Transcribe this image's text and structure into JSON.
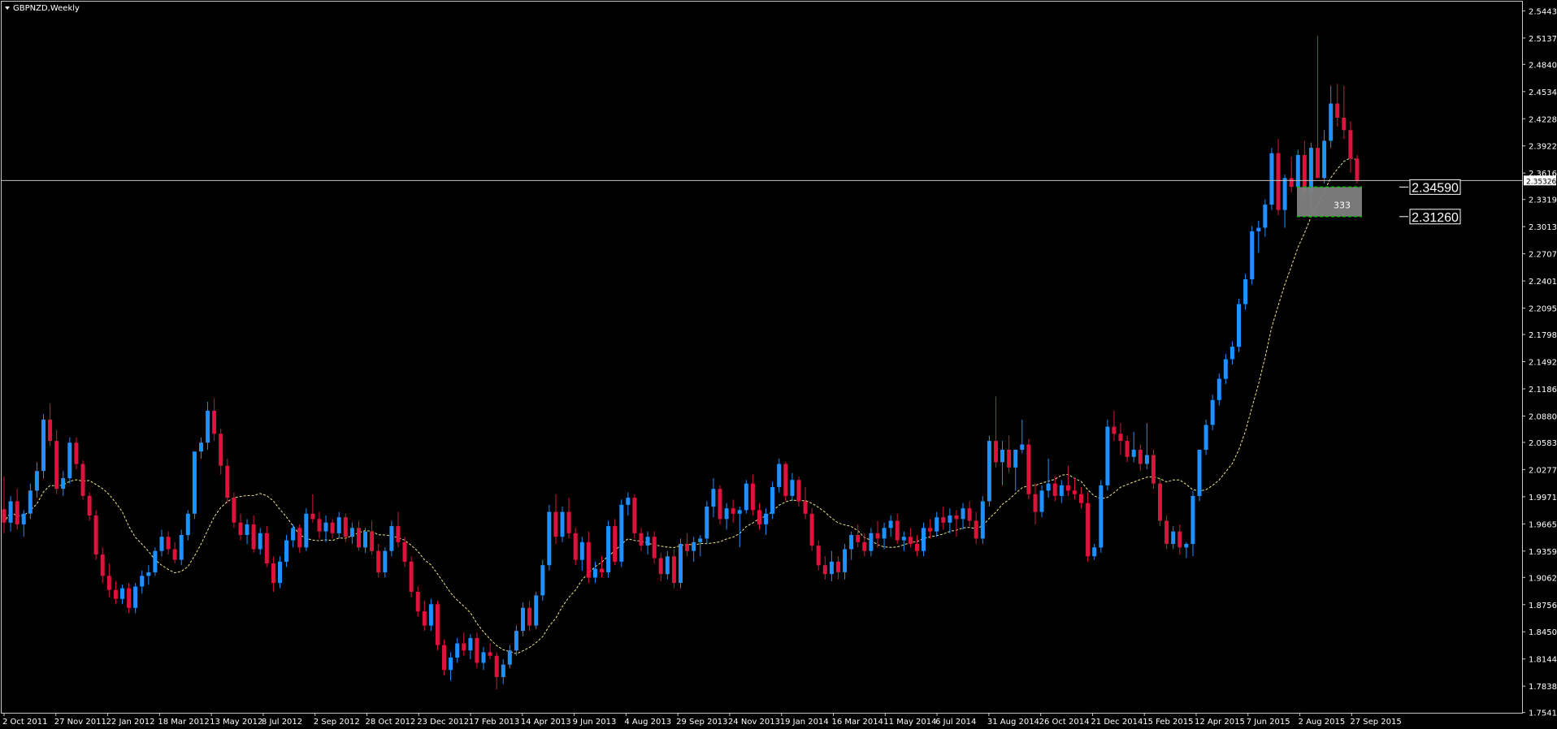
{
  "window": {
    "title": "GBPNZD,Weekly",
    "menu_icon": "triangle-down-icon"
  },
  "colors": {
    "background": "#000000",
    "frame": "#c8c8c8",
    "bull": "#1e90ff",
    "bear": "#dc143c",
    "doji": "#00c000",
    "ma": "#f0e68c",
    "zone_fill": "#808080",
    "zone_border": "#00c000",
    "text": "#ffffff"
  },
  "chart_data": {
    "type": "candlestick",
    "symbol": "GBPNZD",
    "timeframe": "Weekly",
    "ylim": [
      1.7538,
      2.5547
    ],
    "y_ticks": [
      "2.54430",
      "2.51370",
      "2.48400",
      "2.45340",
      "2.42280",
      "2.39220",
      "2.36160",
      "2.33190",
      "2.30130",
      "2.27070",
      "2.24010",
      "2.20950",
      "2.17980",
      "2.14920",
      "2.11860",
      "2.08800",
      "2.05830",
      "2.02770",
      "1.99710",
      "1.96650",
      "1.93590",
      "1.90620",
      "1.87560",
      "1.84500",
      "1.81440",
      "1.78380",
      "1.75410"
    ],
    "x_ticks": [
      "2 Oct 2011",
      "27 Nov 2011",
      "22 Jan 2012",
      "18 Mar 2012",
      "13 May 2012",
      "8 Jul 2012",
      "2 Sep 2012",
      "28 Oct 2012",
      "23 Dec 2012",
      "17 Feb 2013",
      "14 Apr 2013",
      "9 Jun 2013",
      "4 Aug 2013",
      "29 Sep 2013",
      "24 Nov 2013",
      "19 Jan 2014",
      "16 Mar 2014",
      "11 May 2014",
      "6 Jul 2014",
      "31 Aug 2014",
      "26 Oct 2014",
      "21 Dec 2014",
      "15 Feb 2015",
      "12 Apr 2015",
      "7 Jun 2015",
      "2 Aug 2015",
      "27 Sep 2015"
    ],
    "current_price": "2.35326",
    "zone": {
      "upper": "2.34590",
      "lower": "2.31260",
      "label": "333"
    },
    "moving_average": "yellow dashed",
    "grid": false,
    "bars": [
      [
        1.983,
        2.02,
        1.956,
        1.968
      ],
      [
        1.968,
        1.998,
        1.958,
        1.992
      ],
      [
        1.992,
        2.006,
        1.96,
        1.966
      ],
      [
        1.966,
        1.982,
        1.952,
        1.978
      ],
      [
        1.978,
        2.012,
        1.972,
        2.004
      ],
      [
        2.004,
        2.036,
        1.996,
        2.026
      ],
      [
        2.026,
        2.09,
        2.018,
        2.084
      ],
      [
        2.084,
        2.102,
        2.054,
        2.06
      ],
      [
        2.06,
        2.072,
        2.0,
        2.006
      ],
      [
        2.006,
        2.026,
        1.998,
        2.018
      ],
      [
        2.018,
        2.064,
        2.012,
        2.058
      ],
      [
        2.058,
        2.064,
        2.028,
        2.034
      ],
      [
        2.034,
        2.038,
        1.994,
        1.998
      ],
      [
        1.998,
        2.002,
        1.97,
        1.976
      ],
      [
        1.976,
        1.982,
        1.926,
        1.932
      ],
      [
        1.932,
        1.94,
        1.9,
        1.908
      ],
      [
        1.908,
        1.922,
        1.884,
        1.892
      ],
      [
        1.892,
        1.902,
        1.876,
        1.882
      ],
      [
        1.882,
        1.898,
        1.876,
        1.894
      ],
      [
        1.894,
        1.9,
        1.866,
        1.872
      ],
      [
        1.872,
        1.9,
        1.866,
        1.896
      ],
      [
        1.896,
        1.914,
        1.888,
        1.908
      ],
      [
        1.908,
        1.92,
        1.898,
        1.912
      ],
      [
        1.912,
        1.94,
        1.908,
        1.936
      ],
      [
        1.936,
        1.96,
        1.93,
        1.952
      ],
      [
        1.952,
        1.958,
        1.932,
        1.938
      ],
      [
        1.938,
        1.946,
        1.922,
        1.926
      ],
      [
        1.926,
        1.96,
        1.92,
        1.954
      ],
      [
        1.954,
        1.982,
        1.948,
        1.978
      ],
      [
        1.978,
        2.03,
        1.972,
        2.048
      ],
      [
        2.048,
        2.064,
        2.04,
        2.058
      ],
      [
        2.058,
        2.104,
        2.05,
        2.094
      ],
      [
        2.094,
        2.108,
        2.06,
        2.068
      ],
      [
        2.068,
        2.074,
        2.022,
        2.032
      ],
      [
        2.032,
        2.04,
        1.99,
        1.996
      ],
      [
        1.996,
        2.002,
        1.962,
        1.968
      ],
      [
        1.968,
        1.978,
        1.948,
        1.954
      ],
      [
        1.954,
        1.972,
        1.944,
        1.966
      ],
      [
        1.966,
        1.976,
        1.934,
        1.938
      ],
      [
        1.938,
        1.962,
        1.932,
        1.956
      ],
      [
        1.956,
        1.964,
        1.918,
        1.922
      ],
      [
        1.922,
        1.93,
        1.89,
        1.9
      ],
      [
        1.9,
        1.93,
        1.894,
        1.924
      ],
      [
        1.924,
        1.954,
        1.918,
        1.948
      ],
      [
        1.948,
        1.966,
        1.94,
        1.962
      ],
      [
        1.962,
        1.966,
        1.934,
        1.94
      ],
      [
        1.94,
        1.984,
        1.936,
        1.978
      ],
      [
        1.978,
        2.0,
        1.968,
        1.972
      ],
      [
        1.972,
        1.98,
        1.95,
        1.958
      ],
      [
        1.958,
        1.976,
        1.946,
        1.968
      ],
      [
        1.968,
        1.972,
        1.95,
        1.956
      ],
      [
        1.956,
        1.98,
        1.95,
        1.974
      ],
      [
        1.974,
        1.978,
        1.946,
        1.952
      ],
      [
        1.952,
        1.968,
        1.944,
        1.962
      ],
      [
        1.962,
        1.97,
        1.936,
        1.94
      ],
      [
        1.94,
        1.962,
        1.934,
        1.958
      ],
      [
        1.958,
        1.97,
        1.932,
        1.936
      ],
      [
        1.936,
        1.944,
        1.906,
        1.912
      ],
      [
        1.912,
        1.94,
        1.906,
        1.936
      ],
      [
        1.936,
        1.97,
        1.93,
        1.964
      ],
      [
        1.964,
        1.98,
        1.94,
        1.946
      ],
      [
        1.946,
        1.952,
        1.918,
        1.924
      ],
      [
        1.924,
        1.93,
        1.884,
        1.89
      ],
      [
        1.89,
        1.896,
        1.862,
        1.868
      ],
      [
        1.868,
        1.88,
        1.846,
        1.852
      ],
      [
        1.852,
        1.882,
        1.846,
        1.876
      ],
      [
        1.876,
        1.88,
        1.824,
        1.83
      ],
      [
        1.83,
        1.836,
        1.796,
        1.802
      ],
      [
        1.802,
        1.822,
        1.79,
        1.816
      ],
      [
        1.816,
        1.838,
        1.81,
        1.832
      ],
      [
        1.832,
        1.844,
        1.818,
        1.824
      ],
      [
        1.824,
        1.842,
        1.814,
        1.838
      ],
      [
        1.838,
        1.844,
        1.804,
        1.81
      ],
      [
        1.81,
        1.828,
        1.802,
        1.822
      ],
      [
        1.822,
        1.832,
        1.814,
        1.818
      ],
      [
        1.818,
        1.822,
        1.78,
        1.794
      ],
      [
        1.794,
        1.814,
        1.786,
        1.808
      ],
      [
        1.808,
        1.83,
        1.804,
        1.824
      ],
      [
        1.824,
        1.852,
        1.818,
        1.846
      ],
      [
        1.846,
        1.878,
        1.84,
        1.872
      ],
      [
        1.872,
        1.88,
        1.846,
        1.852
      ],
      [
        1.852,
        1.89,
        1.848,
        1.886
      ],
      [
        1.886,
        1.926,
        1.88,
        1.92
      ],
      [
        1.92,
        1.988,
        1.914,
        1.98
      ],
      [
        1.98,
        2.0,
        1.944,
        1.952
      ],
      [
        1.952,
        1.986,
        1.946,
        1.98
      ],
      [
        1.98,
        1.996,
        1.95,
        1.956
      ],
      [
        1.956,
        1.962,
        1.92,
        1.926
      ],
      [
        1.926,
        1.952,
        1.914,
        1.946
      ],
      [
        1.946,
        1.958,
        1.9,
        1.906
      ],
      [
        1.906,
        1.924,
        1.9,
        1.916
      ],
      [
        1.916,
        1.93,
        1.906,
        1.912
      ],
      [
        1.912,
        1.97,
        1.906,
        1.964
      ],
      [
        1.964,
        1.972,
        1.92,
        1.924
      ],
      [
        1.924,
        1.994,
        1.918,
        1.988
      ],
      [
        1.988,
        2.002,
        1.976,
        1.996
      ],
      [
        1.996,
        2.0,
        1.95,
        1.956
      ],
      [
        1.956,
        1.962,
        1.936,
        1.942
      ],
      [
        1.942,
        1.958,
        1.932,
        1.952
      ],
      [
        1.952,
        1.958,
        1.922,
        1.928
      ],
      [
        1.928,
        1.934,
        1.902,
        1.91
      ],
      [
        1.91,
        1.936,
        1.904,
        1.93
      ],
      [
        1.93,
        1.938,
        1.894,
        1.9
      ],
      [
        1.9,
        1.95,
        1.894,
        1.944
      ],
      [
        1.944,
        1.956,
        1.93,
        1.936
      ],
      [
        1.936,
        1.952,
        1.924,
        1.946
      ],
      [
        1.946,
        1.954,
        1.93,
        1.95
      ],
      [
        1.95,
        1.992,
        1.944,
        1.986
      ],
      [
        1.986,
        2.018,
        1.974,
        2.006
      ],
      [
        2.006,
        2.01,
        1.966,
        1.972
      ],
      [
        1.972,
        1.99,
        1.96,
        1.984
      ],
      [
        1.984,
        1.994,
        1.968,
        1.978
      ],
      [
        1.978,
        1.986,
        1.94,
        1.982
      ],
      [
        1.982,
        2.016,
        1.978,
        2.012
      ],
      [
        2.012,
        2.022,
        1.976,
        1.982
      ],
      [
        1.982,
        1.99,
        1.96,
        1.966
      ],
      [
        1.966,
        1.984,
        1.954,
        1.978
      ],
      [
        1.978,
        2.014,
        1.972,
        2.008
      ],
      [
        2.008,
        2.04,
        2.002,
        2.034
      ],
      [
        2.034,
        2.036,
        1.992,
        1.998
      ],
      [
        1.998,
        2.024,
        1.992,
        2.016
      ],
      [
        2.016,
        2.02,
        1.986,
        1.992
      ],
      [
        1.992,
        2.008,
        1.972,
        1.978
      ],
      [
        1.978,
        1.984,
        1.936,
        1.942
      ],
      [
        1.942,
        1.948,
        1.914,
        1.92
      ],
      [
        1.92,
        1.93,
        1.904,
        1.91
      ],
      [
        1.91,
        1.936,
        1.902,
        1.924
      ],
      [
        1.924,
        1.93,
        1.904,
        1.912
      ],
      [
        1.912,
        1.944,
        1.904,
        1.938
      ],
      [
        1.938,
        1.958,
        1.926,
        1.954
      ],
      [
        1.954,
        1.966,
        1.94,
        1.946
      ],
      [
        1.946,
        1.956,
        1.93,
        1.936
      ],
      [
        1.936,
        1.962,
        1.93,
        1.956
      ],
      [
        1.956,
        1.97,
        1.94,
        1.95
      ],
      [
        1.95,
        1.968,
        1.938,
        1.962
      ],
      [
        1.962,
        1.976,
        1.952,
        1.97
      ],
      [
        1.97,
        1.978,
        1.944,
        1.948
      ],
      [
        1.948,
        1.958,
        1.936,
        1.952
      ],
      [
        1.952,
        1.962,
        1.94,
        1.944
      ],
      [
        1.944,
        1.954,
        1.93,
        1.936
      ],
      [
        1.936,
        1.968,
        1.93,
        1.962
      ],
      [
        1.962,
        1.972,
        1.95,
        1.958
      ],
      [
        1.958,
        1.98,
        1.952,
        1.974
      ],
      [
        1.974,
        1.986,
        1.96,
        1.968
      ],
      [
        1.968,
        1.984,
        1.956,
        1.976
      ],
      [
        1.976,
        1.982,
        1.952,
        1.972
      ],
      [
        1.972,
        1.99,
        1.96,
        1.984
      ],
      [
        1.984,
        1.992,
        1.964,
        1.97
      ],
      [
        1.97,
        1.98,
        1.944,
        1.95
      ],
      [
        1.95,
        1.998,
        1.944,
        1.992
      ],
      [
        1.992,
        2.066,
        1.986,
        2.06
      ],
      [
        2.06,
        2.11,
        2.03,
        2.036
      ],
      [
        2.036,
        2.06,
        2.01,
        2.05
      ],
      [
        2.05,
        2.066,
        2.024,
        2.03
      ],
      [
        2.03,
        2.036,
        2.004,
        2.05
      ],
      [
        2.05,
        2.084,
        2.046,
        2.056
      ],
      [
        2.056,
        2.062,
        1.994,
        2.0
      ],
      [
        2.0,
        2.012,
        1.966,
        1.98
      ],
      [
        1.98,
        2.01,
        1.974,
        2.004
      ],
      [
        2.004,
        2.04,
        1.996,
        2.012
      ],
      [
        2.012,
        2.02,
        1.992,
        1.998
      ],
      [
        1.998,
        2.016,
        1.99,
        2.01
      ],
      [
        2.01,
        2.032,
        1.998,
        2.004
      ],
      [
        2.004,
        2.018,
        1.994,
        2.0
      ],
      [
        2.0,
        2.008,
        1.984,
        1.99
      ],
      [
        1.99,
        2.002,
        1.924,
        1.93
      ],
      [
        1.93,
        1.944,
        1.926,
        1.94
      ],
      [
        1.94,
        2.016,
        1.934,
        2.01
      ],
      [
        2.01,
        2.084,
        2.004,
        2.076
      ],
      [
        2.076,
        2.094,
        2.06,
        2.068
      ],
      [
        2.068,
        2.08,
        2.044,
        2.06
      ],
      [
        2.06,
        2.066,
        2.036,
        2.042
      ],
      [
        2.042,
        2.07,
        2.036,
        2.05
      ],
      [
        2.05,
        2.056,
        2.026,
        2.034
      ],
      [
        2.034,
        2.08,
        2.028,
        2.044
      ],
      [
        2.044,
        2.05,
        2.006,
        2.012
      ],
      [
        2.012,
        2.018,
        1.964,
        1.97
      ],
      [
        1.97,
        1.976,
        1.938,
        1.944
      ],
      [
        1.944,
        1.964,
        1.938,
        1.958
      ],
      [
        1.958,
        1.966,
        1.932,
        1.94
      ],
      [
        1.94,
        1.946,
        1.928,
        1.944
      ],
      [
        1.944,
        2.004,
        1.93,
        1.998
      ],
      [
        1.998,
        2.04,
        1.992,
        2.05
      ],
      [
        2.05,
        2.084,
        2.044,
        2.078
      ],
      [
        2.078,
        2.112,
        2.072,
        2.106
      ],
      [
        2.106,
        2.136,
        2.1,
        2.13
      ],
      [
        2.13,
        2.158,
        2.124,
        2.152
      ],
      [
        2.152,
        2.172,
        2.146,
        2.166
      ],
      [
        2.166,
        2.22,
        2.16,
        2.214
      ],
      [
        2.214,
        2.248,
        2.208,
        2.242
      ],
      [
        2.242,
        2.302,
        2.236,
        2.296
      ],
      [
        2.296,
        2.308,
        2.272,
        2.3
      ],
      [
        2.3,
        2.332,
        2.29,
        2.326
      ],
      [
        2.326,
        2.39,
        2.32,
        2.384
      ],
      [
        2.384,
        2.4,
        2.314,
        2.32
      ],
      [
        2.32,
        2.36,
        2.3,
        2.356
      ],
      [
        2.356,
        2.38,
        2.34,
        2.346
      ],
      [
        2.346,
        2.388,
        2.322,
        2.382
      ],
      [
        2.382,
        2.398,
        2.332,
        2.34
      ],
      [
        2.34,
        2.396,
        2.316,
        2.39
      ],
      [
        2.39,
        2.516,
        2.374,
        2.356
      ],
      [
        2.356,
        2.41,
        2.35,
        2.398
      ],
      [
        2.398,
        2.46,
        2.39,
        2.44
      ],
      [
        2.44,
        2.462,
        2.414,
        2.424
      ],
      [
        2.424,
        2.46,
        2.4,
        2.41
      ],
      [
        2.41,
        2.42,
        2.362,
        2.378
      ],
      [
        2.378,
        2.382,
        2.35,
        2.353
      ]
    ]
  }
}
